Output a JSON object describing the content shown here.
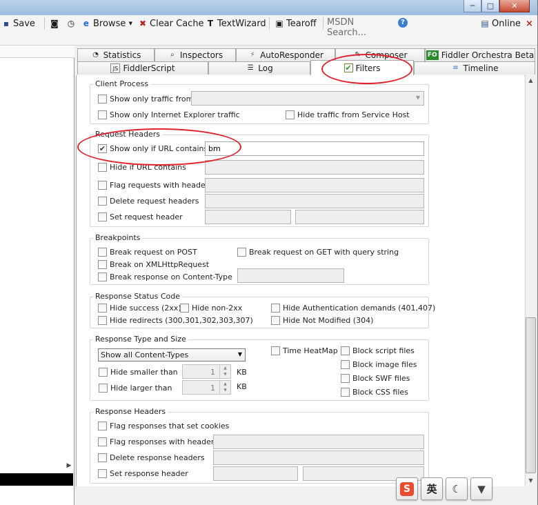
{
  "window": {
    "minimize": "─",
    "maximize": "□",
    "close": "✕"
  },
  "toolbar": {
    "save": "Save",
    "browse": "Browse",
    "clear_cache": "Clear Cache",
    "textwizard": "TextWizard",
    "tearoff": "Tearoff",
    "msdn_search": "MSDN Search...",
    "online": "Online",
    "close_x": "×"
  },
  "tabs_top": [
    "Statistics",
    "Inspectors",
    "AutoResponder",
    "Composer",
    "Fiddler Orchestra Beta"
  ],
  "tabs_bottom": [
    "FiddlerScript",
    "Log",
    "Filters",
    "Timeline"
  ],
  "tab_badges": {
    "fiddlerscript": "JS",
    "orchestra": "FO"
  },
  "client_process": {
    "title": "Client Process",
    "show_only_traffic_from": "Show only traffic from",
    "show_only_ie": "Show only Internet Explorer traffic",
    "hide_service_host": "Hide traffic from Service Host"
  },
  "request_headers": {
    "title": "Request Headers",
    "show_only_url": "Show only if URL contains",
    "show_only_url_value": "bm",
    "hide_url": "Hide if URL contains",
    "flag_requests": "Flag requests with headers",
    "delete_request": "Delete request headers",
    "set_request": "Set request header"
  },
  "breakpoints": {
    "title": "Breakpoints",
    "break_post": "Break request on POST",
    "break_get": "Break request on GET with query string",
    "break_xhr": "Break on XMLHttpRequest",
    "break_content_type": "Break response on Content-Type"
  },
  "response_status": {
    "title": "Response Status Code",
    "hide_success": "Hide success (2xx)",
    "hide_non2xx": "Hide non-2xx",
    "hide_auth": "Hide Authentication demands (401,407)",
    "hide_redirects": "Hide redirects (300,301,302,303,307)",
    "hide_not_modified": "Hide Not Modified (304)"
  },
  "response_type": {
    "title": "Response Type and Size",
    "content_types_selected": "Show all Content-Types",
    "time_heatmap": "Time HeatMap",
    "block_script": "Block script files",
    "block_image": "Block image files",
    "block_swf": "Block SWF files",
    "block_css": "Block CSS files",
    "hide_smaller": "Hide smaller than",
    "hide_larger": "Hide larger than",
    "smaller_value": "1",
    "larger_value": "1",
    "unit": "KB"
  },
  "response_headers": {
    "title": "Response Headers",
    "flag_cookies": "Flag responses that set cookies",
    "flag_headers": "Flag responses with headers",
    "delete_response": "Delete response headers",
    "set_response": "Set response header"
  },
  "checked": {
    "filters_tab": "✔",
    "show_only_url": "✔"
  },
  "ime": {
    "lang": "英",
    "sogou": "S"
  },
  "colors": {
    "annotation": "#e0202a",
    "active_tab": "#ffffff"
  }
}
